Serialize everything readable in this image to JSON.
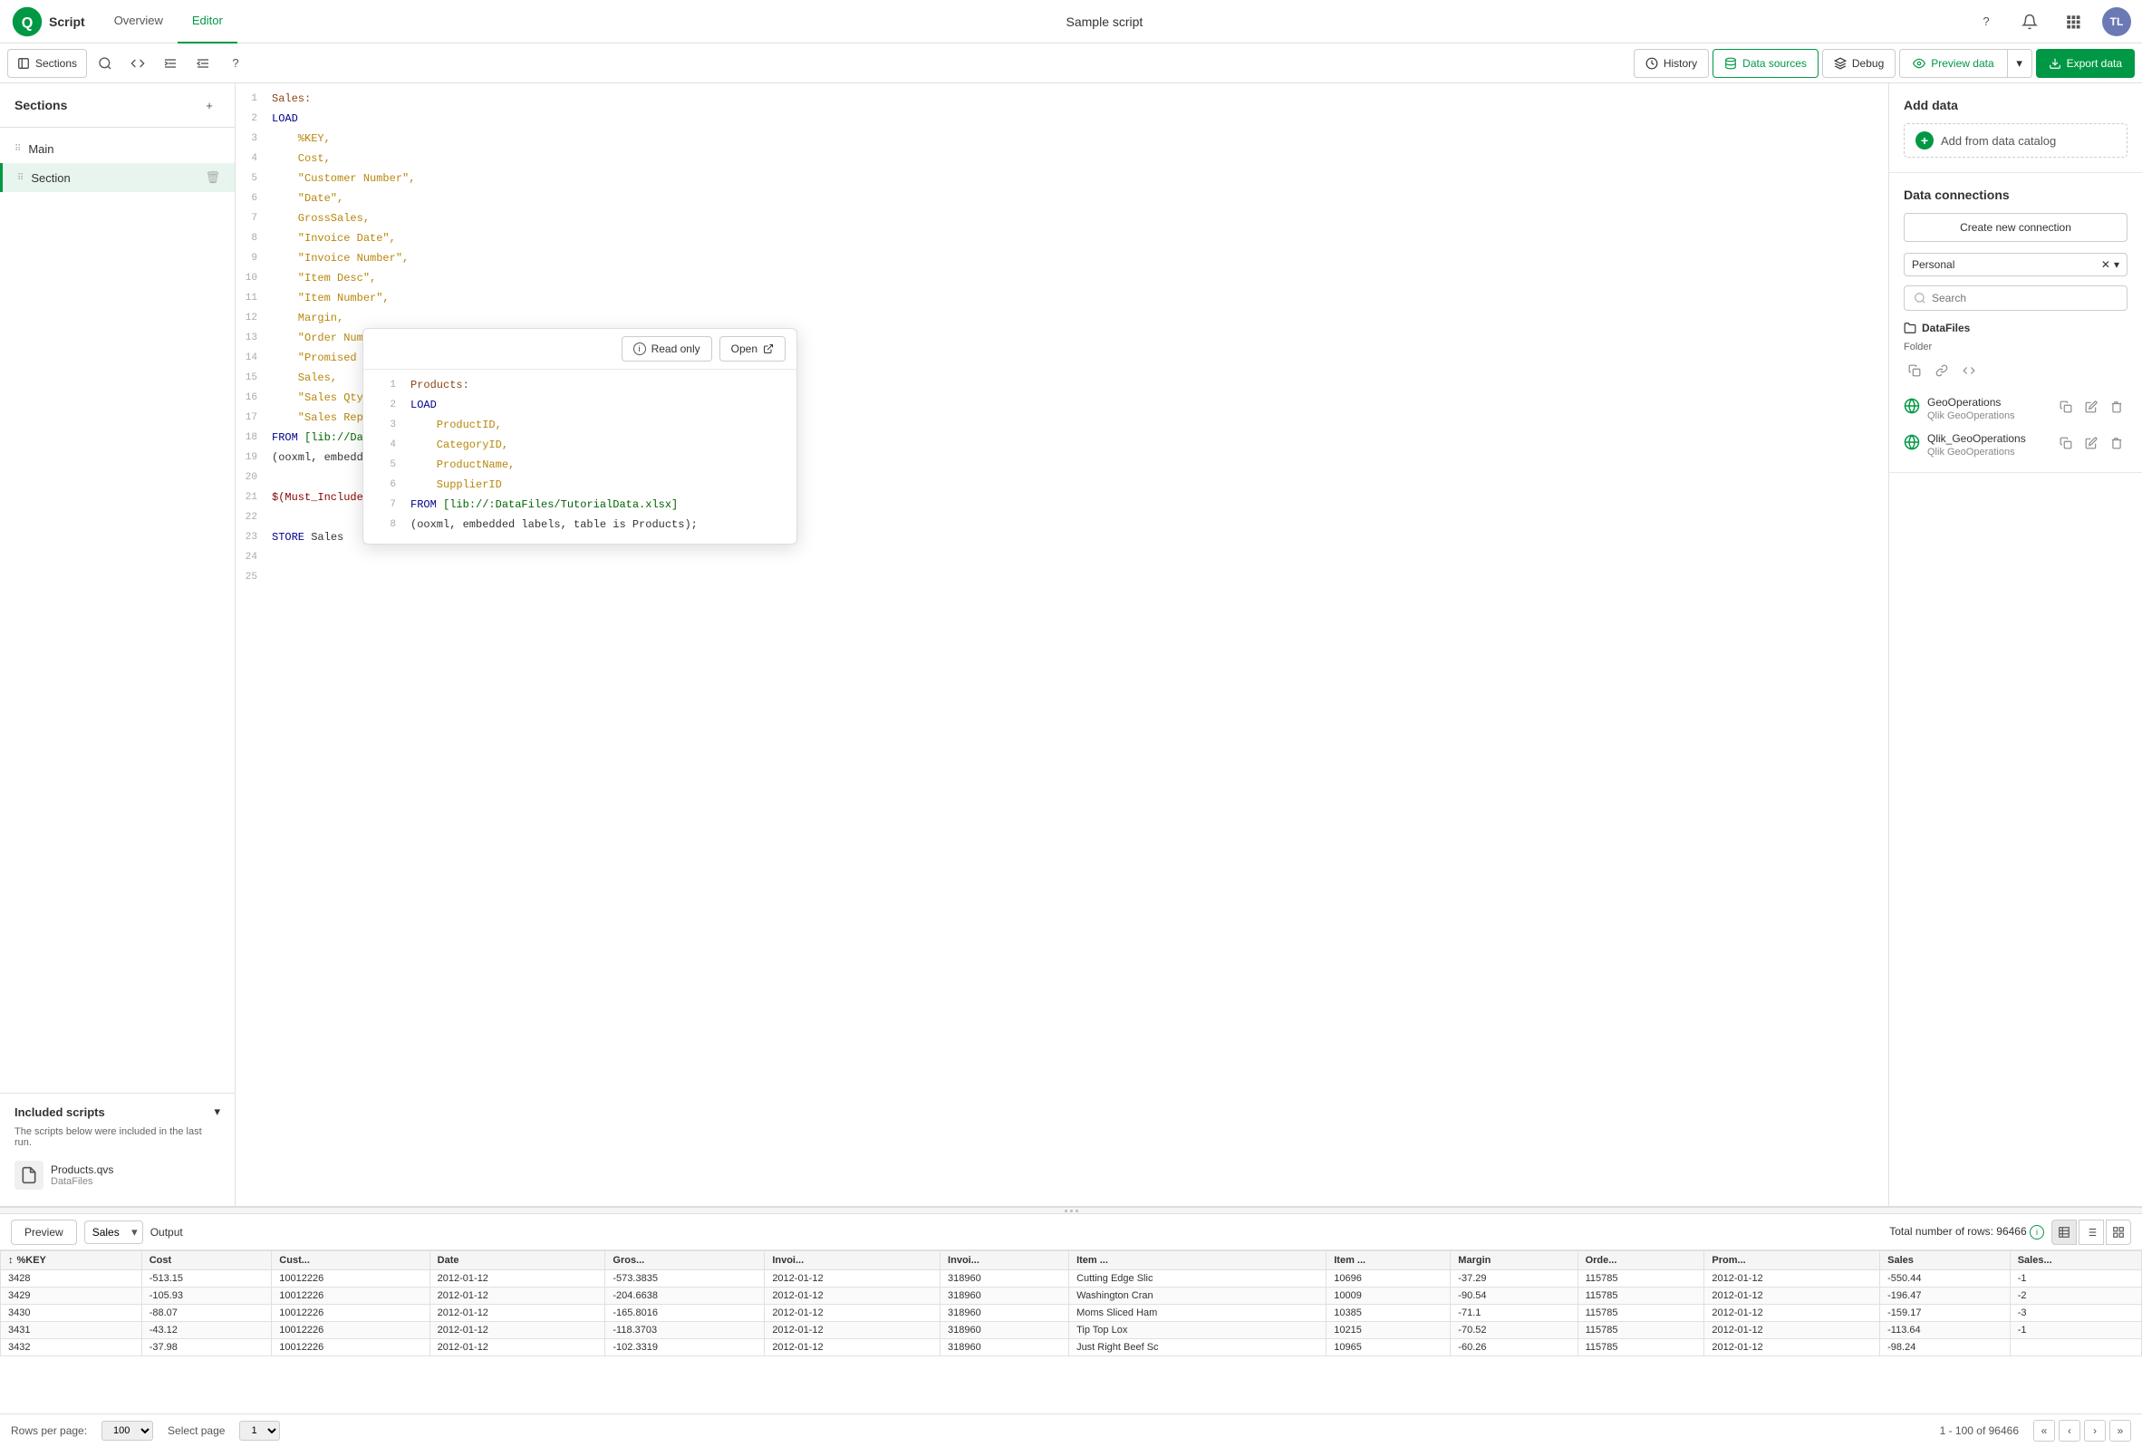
{
  "app": {
    "name": "Script",
    "title": "Sample script"
  },
  "nav": {
    "tabs": [
      {
        "id": "overview",
        "label": "Overview",
        "active": false
      },
      {
        "id": "editor",
        "label": "Editor",
        "active": true
      }
    ],
    "actions": {
      "help_icon": "?",
      "bell_icon": "🔔",
      "grid_icon": "⋯",
      "avatar": "TL"
    }
  },
  "toolbar": {
    "sections_label": "Sections",
    "history_label": "History",
    "data_sources_label": "Data sources",
    "debug_label": "Debug",
    "preview_label": "Preview data",
    "export_label": "Export data"
  },
  "sidebar": {
    "title": "Sections",
    "items": [
      {
        "id": "main",
        "label": "Main",
        "active": false
      },
      {
        "id": "section",
        "label": "Section",
        "active": true
      }
    ],
    "included_scripts": {
      "title": "Included scripts",
      "description": "The scripts below were included in the last run.",
      "files": [
        {
          "name": "Products.qvs",
          "source": "DataFiles"
        }
      ]
    }
  },
  "editor": {
    "lines": [
      {
        "num": 1,
        "content": "Sales:",
        "type": "table"
      },
      {
        "num": 2,
        "content": "LOAD",
        "type": "keyword"
      },
      {
        "num": 3,
        "content": "    %KEY,",
        "type": "field"
      },
      {
        "num": 4,
        "content": "    Cost,",
        "type": "field"
      },
      {
        "num": 5,
        "content": "    \"Customer Number\",",
        "type": "string"
      },
      {
        "num": 6,
        "content": "    \"Date\",",
        "type": "string"
      },
      {
        "num": 7,
        "content": "    GrossSales,",
        "type": "field"
      },
      {
        "num": 8,
        "content": "    \"Invoice Date\",",
        "type": "string"
      },
      {
        "num": 9,
        "content": "    \"Invoice Number\",",
        "type": "string"
      },
      {
        "num": 10,
        "content": "    \"Item Desc\",",
        "type": "string"
      },
      {
        "num": 11,
        "content": "    \"Item Number\",",
        "type": "string"
      },
      {
        "num": 12,
        "content": "    Margin,",
        "type": "field"
      },
      {
        "num": 13,
        "content": "    \"Order Number\",",
        "type": "string"
      },
      {
        "num": 14,
        "content": "    \"Promised Delivery Date\",",
        "type": "string"
      },
      {
        "num": 15,
        "content": "    Sales,",
        "type": "field"
      },
      {
        "num": 16,
        "content": "    \"Sales Qty\",",
        "type": "string"
      },
      {
        "num": 17,
        "content": "    \"Sales Rep Number\"",
        "type": "string"
      },
      {
        "num": 18,
        "content": "FROM [lib://DataFiles/Sales.xlsx]",
        "type": "path"
      },
      {
        "num": 19,
        "content": "(ooxml, embedded labels, table is Sales);",
        "type": "normal"
      },
      {
        "num": 20,
        "content": "",
        "type": "normal"
      },
      {
        "num": 21,
        "content": "$(Must_Include=lib://DataFiles/Products.qvs);",
        "type": "include"
      },
      {
        "num": 22,
        "content": "",
        "type": "normal"
      },
      {
        "num": 23,
        "content": "STORE Sales",
        "type": "keyword"
      },
      {
        "num": 24,
        "content": "",
        "type": "normal"
      },
      {
        "num": 25,
        "content": "",
        "type": "normal"
      }
    ]
  },
  "popup": {
    "readonly_label": "Read only",
    "open_label": "Open",
    "code_lines": [
      {
        "num": 1,
        "content": "Products:",
        "type": "table"
      },
      {
        "num": 2,
        "content": "LOAD",
        "type": "keyword"
      },
      {
        "num": 3,
        "content": "    ProductID,",
        "type": "field"
      },
      {
        "num": 4,
        "content": "    CategoryID,",
        "type": "field"
      },
      {
        "num": 5,
        "content": "    ProductName,",
        "type": "field"
      },
      {
        "num": 6,
        "content": "    SupplierID",
        "type": "field"
      },
      {
        "num": 7,
        "content": "FROM [lib://:DataFiles/TutorialData.xlsx]",
        "type": "path"
      },
      {
        "num": 8,
        "content": "(ooxml, embedded labels, table is Products);",
        "type": "normal"
      }
    ]
  },
  "right_panel": {
    "add_data": {
      "title": "Add data",
      "catalog_label": "Add from data catalog"
    },
    "connections": {
      "title": "Data connections",
      "create_label": "Create new connection",
      "filter": {
        "selected": "Personal",
        "placeholder": "Search"
      },
      "groups": [
        {
          "name": "DataFiles",
          "type": "Folder",
          "items": []
        },
        {
          "name": "GeoOperations",
          "label": "Qlik GeoOperations",
          "globe": true
        },
        {
          "name": "Qlik_GeoOperations",
          "label": "Qlik GeoOperations",
          "globe": true
        }
      ]
    }
  },
  "bottom": {
    "preview_label": "Preview",
    "table_select": "Sales",
    "output_label": "Output",
    "row_count_label": "Total number of rows: 96466",
    "columns": [
      "%KEY",
      "Cost",
      "Cust...",
      "Date",
      "Gros...",
      "Invoi...",
      "Invoi...",
      "Item ...",
      "Item ...",
      "Margin",
      "Orde...",
      "Prom...",
      "Sales",
      "Sales..."
    ],
    "rows": [
      [
        "3428",
        "-513.15",
        "10012226",
        "2012-01-12",
        "-573.3835",
        "2012-01-12",
        "318960",
        "Cutting Edge Slic",
        "10696",
        "-37.29",
        "115785",
        "2012-01-12",
        "-550.44",
        "-1"
      ],
      [
        "3429",
        "-105.93",
        "10012226",
        "2012-01-12",
        "-204.6638",
        "2012-01-12",
        "318960",
        "Washington Cran",
        "10009",
        "-90.54",
        "115785",
        "2012-01-12",
        "-196.47",
        "-2"
      ],
      [
        "3430",
        "-88.07",
        "10012226",
        "2012-01-12",
        "-165.8016",
        "2012-01-12",
        "318960",
        "Moms Sliced Ham",
        "10385",
        "-71.1",
        "115785",
        "2012-01-12",
        "-159.17",
        "-3"
      ],
      [
        "3431",
        "-43.12",
        "10012226",
        "2012-01-12",
        "-118.3703",
        "2012-01-12",
        "318960",
        "Tip Top Lox",
        "10215",
        "-70.52",
        "115785",
        "2012-01-12",
        "-113.64",
        "-1"
      ],
      [
        "3432",
        "-37.98",
        "10012226",
        "2012-01-12",
        "-102.3319",
        "2012-01-12",
        "318960",
        "Just Right Beef Sc",
        "10965",
        "-60.26",
        "115785",
        "2012-01-12",
        "-98.24",
        ""
      ]
    ],
    "footer": {
      "rows_per_page_label": "Rows per page:",
      "rows_per_page_value": "100",
      "select_page_label": "Select page",
      "page_value": "1",
      "range_label": "1 - 100 of 96466"
    }
  }
}
